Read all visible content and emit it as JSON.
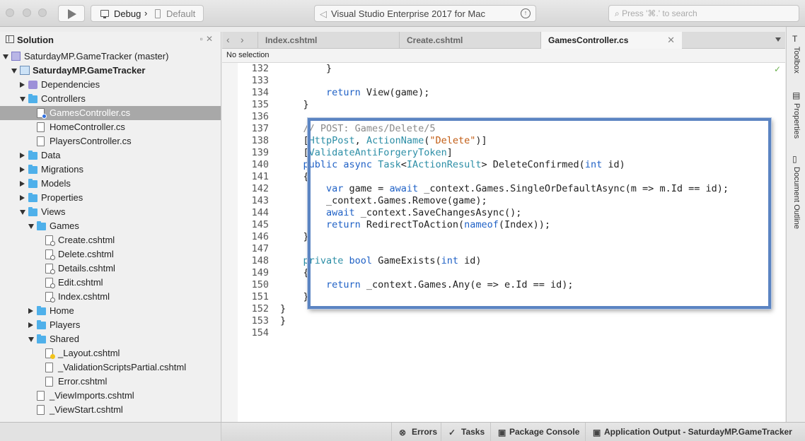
{
  "toolbar": {
    "configuration": "Debug",
    "separator": "›",
    "target": "Default",
    "status": "Visual Studio Enterprise 2017 for Mac",
    "search_placeholder": "Press '⌘.' to search",
    "icons": [
      "play-icon",
      "monitor-icon",
      "device-icon",
      "vs-logo-icon",
      "update-icon",
      "search-icon"
    ]
  },
  "solution_pad": {
    "title": "Solution",
    "items": [
      {
        "label": "SaturdayMP.GameTracker (master)",
        "icon": "solution",
        "depth": 0,
        "expanded": true,
        "bold": false
      },
      {
        "label": "SaturdayMP.GameTracker",
        "icon": "project",
        "depth": 1,
        "expanded": true,
        "bold": true
      },
      {
        "label": "Dependencies",
        "icon": "dependencies",
        "depth": 2,
        "expanded": false
      },
      {
        "label": "Controllers",
        "icon": "folder",
        "depth": 2,
        "expanded": true
      },
      {
        "label": "GamesController.cs",
        "icon": "file",
        "depth": 3,
        "selected": true
      },
      {
        "label": "HomeController.cs",
        "icon": "file",
        "depth": 3
      },
      {
        "label": "PlayersController.cs",
        "icon": "file",
        "depth": 3
      },
      {
        "label": "Data",
        "icon": "folder",
        "depth": 2,
        "expanded": false
      },
      {
        "label": "Migrations",
        "icon": "folder",
        "depth": 2,
        "expanded": false
      },
      {
        "label": "Models",
        "icon": "folder",
        "depth": 2,
        "expanded": false
      },
      {
        "label": "Properties",
        "icon": "folder",
        "depth": 2,
        "expanded": false
      },
      {
        "label": "Views",
        "icon": "folder",
        "depth": 2,
        "expanded": true
      },
      {
        "label": "Games",
        "icon": "folder",
        "depth": 3,
        "expanded": true
      },
      {
        "label": "Create.cshtml",
        "icon": "file",
        "depth": 4
      },
      {
        "label": "Delete.cshtml",
        "icon": "file",
        "depth": 4
      },
      {
        "label": "Details.cshtml",
        "icon": "file",
        "depth": 4
      },
      {
        "label": "Edit.cshtml",
        "icon": "file",
        "depth": 4
      },
      {
        "label": "Index.cshtml",
        "icon": "file",
        "depth": 4
      },
      {
        "label": "Home",
        "icon": "folder",
        "depth": 3,
        "expanded": false
      },
      {
        "label": "Players",
        "icon": "folder",
        "depth": 3,
        "expanded": false
      },
      {
        "label": "Shared",
        "icon": "folder",
        "depth": 3,
        "expanded": true
      },
      {
        "label": "_Layout.cshtml",
        "icon": "file",
        "depth": 4
      },
      {
        "label": "_ValidationScriptsPartial.cshtml",
        "icon": "file",
        "depth": 4
      },
      {
        "label": "Error.cshtml",
        "icon": "file",
        "depth": 4
      },
      {
        "label": "_ViewImports.cshtml",
        "icon": "file",
        "depth": 3
      },
      {
        "label": "_ViewStart.cshtml",
        "icon": "file",
        "depth": 3
      }
    ]
  },
  "editor": {
    "tabs": [
      {
        "label": "Index.cshtml",
        "active": false
      },
      {
        "label": "Create.cshtml",
        "active": false
      },
      {
        "label": "GamesController.cs",
        "active": true
      }
    ],
    "path_bar": "No selection",
    "lines": [
      {
        "n": "132",
        "t": [
          [
            "",
            "        }"
          ]
        ]
      },
      {
        "n": "133",
        "t": []
      },
      {
        "n": "134",
        "t": [
          [
            "kw",
            "        return"
          ],
          [
            "",
            " View(game);"
          ]
        ]
      },
      {
        "n": "135",
        "t": [
          [
            "",
            "    }"
          ]
        ]
      },
      {
        "n": "136",
        "t": []
      },
      {
        "n": "137",
        "t": [
          [
            "cm",
            "    // POST: Games/Delete/5"
          ]
        ]
      },
      {
        "n": "138",
        "t": [
          [
            "",
            "    ["
          ],
          [
            "ty",
            "HttpPost"
          ],
          [
            "",
            ", "
          ],
          [
            "ty",
            "ActionName"
          ],
          [
            "",
            "("
          ],
          [
            "st",
            "\"Delete\""
          ],
          [
            "",
            ")]"
          ]
        ]
      },
      {
        "n": "139",
        "t": [
          [
            "",
            "    ["
          ],
          [
            "ty",
            "ValidateAntiForgeryToken"
          ],
          [
            "",
            "]"
          ]
        ]
      },
      {
        "n": "140",
        "t": [
          [
            "kw",
            "    public async"
          ],
          [
            "",
            " "
          ],
          [
            "ty",
            "Task"
          ],
          [
            "",
            "<"
          ],
          [
            "ty",
            "IActionResult"
          ],
          [
            "",
            "> DeleteConfirmed("
          ],
          [
            "kw",
            "int"
          ],
          [
            "",
            " id)"
          ]
        ]
      },
      {
        "n": "141",
        "t": [
          [
            "",
            "    {"
          ]
        ]
      },
      {
        "n": "142",
        "t": [
          [
            "kw",
            "        var"
          ],
          [
            "",
            " game = "
          ],
          [
            "kw",
            "await"
          ],
          [
            "",
            " _context.Games.SingleOrDefaultAsync(m => m.Id == id);"
          ]
        ]
      },
      {
        "n": "143",
        "t": [
          [
            "",
            "        _context.Games.Remove(game);"
          ]
        ]
      },
      {
        "n": "144",
        "t": [
          [
            "kw",
            "        await"
          ],
          [
            "",
            " _context.SaveChangesAsync();"
          ]
        ]
      },
      {
        "n": "145",
        "t": [
          [
            "kw",
            "        return"
          ],
          [
            "",
            " RedirectToAction("
          ],
          [
            "kw",
            "nameof"
          ],
          [
            "",
            "(Index));"
          ]
        ]
      },
      {
        "n": "146",
        "t": [
          [
            "",
            "    }"
          ]
        ]
      },
      {
        "n": "147",
        "t": []
      },
      {
        "n": "148",
        "t": [
          [
            "ty",
            "    private"
          ],
          [
            "",
            " "
          ],
          [
            "kw",
            "bool"
          ],
          [
            "",
            " GameExists("
          ],
          [
            "kw",
            "int"
          ],
          [
            "",
            " id)"
          ]
        ]
      },
      {
        "n": "149",
        "t": [
          [
            "",
            "    {"
          ]
        ]
      },
      {
        "n": "150",
        "t": [
          [
            "kw",
            "        return"
          ],
          [
            "",
            " _context.Games.Any(e => e.Id == id);"
          ]
        ]
      },
      {
        "n": "151",
        "t": [
          [
            "",
            "    }"
          ]
        ]
      },
      {
        "n": "152",
        "t": [
          [
            "",
            "}"
          ]
        ]
      },
      {
        "n": "153",
        "t": [
          [
            "",
            "}"
          ]
        ]
      },
      {
        "n": "154",
        "t": []
      }
    ]
  },
  "dock": {
    "items": [
      "Toolbox",
      "Properties",
      "Document Outline"
    ]
  },
  "statusbar": {
    "errors": "Errors",
    "tasks": "Tasks",
    "package_console": "Package Console",
    "app_output": "Application Output - SaturdayMP.GameTracker"
  },
  "colors": {
    "keyword": "#1f61c6",
    "type": "#2c8ea6",
    "string": "#c25d15",
    "comment": "#8a8a8a",
    "folder": "#4fb0ea",
    "selection": "#a8a8a8",
    "highlight_border": "#5b84c2"
  }
}
